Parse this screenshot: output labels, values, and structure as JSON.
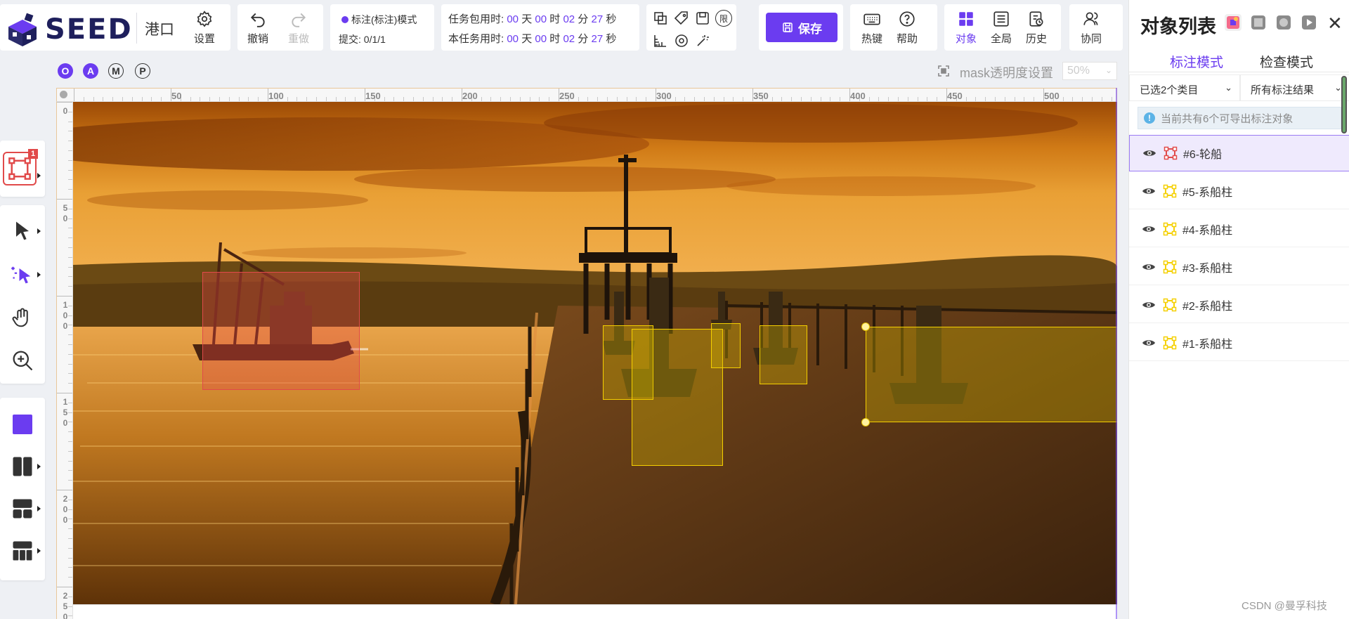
{
  "app": {
    "logo_text": "SEED",
    "project_name": "港口"
  },
  "toolbar": {
    "settings_label": "设置",
    "undo_label": "撤销",
    "redo_label": "重做",
    "mode_label": "标注(标注)模式",
    "submit_label": "提交: 0/1/1",
    "timer_package_label": "任务包用时:",
    "timer_package": {
      "days": "00",
      "hours": "00",
      "minutes": "02",
      "seconds": "27"
    },
    "timer_task_label": "本任务用时:",
    "timer_task": {
      "days": "00",
      "hours": "00",
      "minutes": "02",
      "seconds": "27"
    },
    "unit_day": "天",
    "unit_hour": "时",
    "unit_minute": "分",
    "unit_second": "秒",
    "limit_icon_text": "限",
    "save_label": "保存",
    "hotkey_label": "热键",
    "help_label": "帮助",
    "object_label": "对象",
    "global_label": "全局",
    "history_label": "历史",
    "collab_label": "协同"
  },
  "left_toolbar": {
    "active_tool_badge": "1",
    "accent_color": "#6b3cf0",
    "tools": [
      "rect-tool",
      "select-tool",
      "smart-select-tool",
      "pan-tool",
      "zoom-tool",
      "color-swatch",
      "layout-split-tool",
      "layout-top-tool",
      "layout-grid-tool"
    ]
  },
  "view_bar": {
    "mode_buttons": [
      "O",
      "A",
      "M",
      "P"
    ],
    "mask_label": "mask透明度设置",
    "mask_value": "50%"
  },
  "rulers": {
    "top_labels": [
      "50",
      "100",
      "150",
      "200",
      "250",
      "300",
      "350",
      "400",
      "450",
      "500"
    ],
    "left_labels": [
      "0",
      "50",
      "100",
      "150",
      "200",
      "250"
    ]
  },
  "annotations": [
    {
      "id": "#6",
      "label": "轮船",
      "type": "ship",
      "color": "#e14a4a"
    },
    {
      "id": "#5",
      "label": "系船柱",
      "type": "bollard",
      "color": "#f5d000"
    },
    {
      "id": "#4",
      "label": "系船柱",
      "type": "bollard",
      "color": "#f5d000"
    },
    {
      "id": "#3",
      "label": "系船柱",
      "type": "bollard",
      "color": "#f5d000"
    },
    {
      "id": "#2",
      "label": "系船柱",
      "type": "bollard",
      "color": "#f5d000"
    },
    {
      "id": "#1",
      "label": "系船柱",
      "type": "bollard",
      "color": "#f5d000"
    }
  ],
  "right_panel": {
    "title": "对象列表",
    "tab_label_mode": "标注模式",
    "tab_review_mode": "检查模式",
    "filter_category": "已选2个类目",
    "filter_results": "所有标注结果",
    "info_text": "当前共有6个可导出标注对象",
    "items": [
      {
        "text": "#6-轮船",
        "color": "#e14a4a",
        "selected": true
      },
      {
        "text": "#5-系船柱",
        "color": "#f5d000",
        "selected": false
      },
      {
        "text": "#4-系船柱",
        "color": "#f5d000",
        "selected": false
      },
      {
        "text": "#3-系船柱",
        "color": "#f5d000",
        "selected": false
      },
      {
        "text": "#2-系船柱",
        "color": "#f5d000",
        "selected": false
      },
      {
        "text": "#1-系船柱",
        "color": "#f5d000",
        "selected": false
      }
    ]
  },
  "watermark": "CSDN @曼孚科技"
}
